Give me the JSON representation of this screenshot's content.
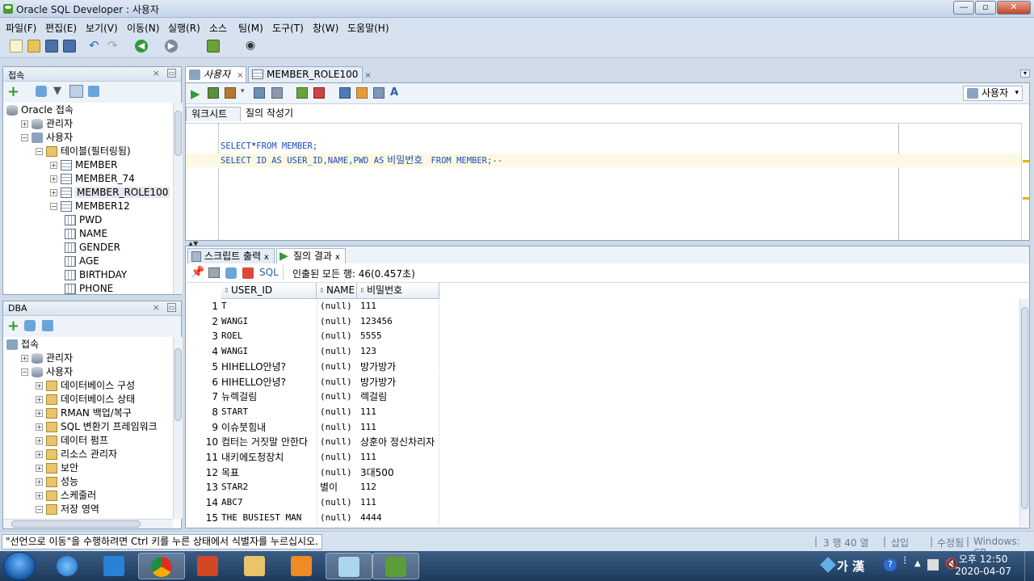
{
  "window": {
    "title": "Oracle SQL Developer : 사용자"
  },
  "menu": [
    "파일(F)",
    "편집(E)",
    "보기(V)",
    "이동(N)",
    "실행(R)",
    "소스",
    "팀(M)",
    "도구(T)",
    "창(W)",
    "도움말(H)"
  ],
  "connections_panel": {
    "title": "접속",
    "tree": [
      {
        "label": "Oracle 접속",
        "level": 0,
        "expander": "",
        "icon": "database-icon"
      },
      {
        "label": "관리자",
        "level": 1,
        "expander": "+",
        "icon": "database-icon"
      },
      {
        "label": "사용자",
        "level": 1,
        "expander": "−",
        "icon": "connection-icon"
      },
      {
        "label": "테이블(필터링됨)",
        "level": 2,
        "expander": "−",
        "icon": "folder-icon"
      },
      {
        "label": "MEMBER",
        "level": 3,
        "expander": "+",
        "icon": "table-icon"
      },
      {
        "label": "MEMBER_74",
        "level": 3,
        "expander": "+",
        "icon": "table-icon"
      },
      {
        "label": "MEMBER_ROLE100",
        "level": 3,
        "expander": "+",
        "icon": "table-icon",
        "selected": true
      },
      {
        "label": "MEMBER12",
        "level": 3,
        "expander": "−",
        "icon": "table-icon"
      },
      {
        "label": "PWD",
        "level": 4,
        "expander": "",
        "icon": "column-icon"
      },
      {
        "label": "NAME",
        "level": 4,
        "expander": "",
        "icon": "column-icon"
      },
      {
        "label": "GENDER",
        "level": 4,
        "expander": "",
        "icon": "column-icon"
      },
      {
        "label": "AGE",
        "level": 4,
        "expander": "",
        "icon": "column-icon"
      },
      {
        "label": "BIRTHDAY",
        "level": 4,
        "expander": "",
        "icon": "column-icon"
      },
      {
        "label": "PHONE",
        "level": 4,
        "expander": "",
        "icon": "column-icon"
      }
    ]
  },
  "dba_panel": {
    "title": "DBA",
    "tree": [
      {
        "label": "접속",
        "level": 0,
        "expander": "",
        "icon": "connection-icon"
      },
      {
        "label": "관리자",
        "level": 1,
        "expander": "+",
        "icon": "database-icon"
      },
      {
        "label": "사용자",
        "level": 1,
        "expander": "−",
        "icon": "database-icon"
      },
      {
        "label": "데이터베이스 구성",
        "level": 2,
        "expander": "+",
        "icon": "folder-icon"
      },
      {
        "label": "데이터베이스 상태",
        "level": 2,
        "expander": "+",
        "icon": "folder-icon"
      },
      {
        "label": "RMAN 백업/복구",
        "level": 2,
        "expander": "+",
        "icon": "folder-icon"
      },
      {
        "label": "SQL 변환기 프레임워크",
        "level": 2,
        "expander": "+",
        "icon": "folder-icon"
      },
      {
        "label": "데이터 펌프",
        "level": 2,
        "expander": "+",
        "icon": "folder-icon"
      },
      {
        "label": "리소스 관리자",
        "level": 2,
        "expander": "+",
        "icon": "folder-icon"
      },
      {
        "label": "보안",
        "level": 2,
        "expander": "+",
        "icon": "folder-icon"
      },
      {
        "label": "성능",
        "level": 2,
        "expander": "+",
        "icon": "folder-icon"
      },
      {
        "label": "스케줄러",
        "level": 2,
        "expander": "+",
        "icon": "folder-icon"
      },
      {
        "label": "저장 영역",
        "level": 2,
        "expander": "−",
        "icon": "folder-icon"
      }
    ]
  },
  "editor_tabs": [
    {
      "label": "사용자",
      "active": true
    },
    {
      "label": "MEMBER_ROLE100",
      "active": false
    }
  ],
  "connection_selector": "사용자",
  "worksheet_subtabs": [
    "워크시트",
    "질의 작성기"
  ],
  "sql": {
    "line1": {
      "a": "SELECT",
      "b": "*",
      "c": "FROM",
      "d": " MEMBER;"
    },
    "line2": {
      "a": "SELECT",
      "b": " ID ",
      "c": "AS",
      "d": " USER_ID,NAME,PWD ",
      "e": "AS",
      "f": " 비밀번호 ",
      "g": " FROM",
      "h": " MEMBER;--"
    }
  },
  "result_tabs": [
    {
      "label": "스크립트 출력",
      "active": false
    },
    {
      "label": "질의 결과",
      "active": true
    }
  ],
  "results_toolbar": {
    "sql_label": "SQL",
    "fetch_status": "인출된 모든 행: 46(0.457초)"
  },
  "grid": {
    "columns": [
      "USER_ID",
      "NAME",
      "비밀번호"
    ],
    "rows": [
      [
        "1",
        "T",
        "(null)",
        "111"
      ],
      [
        "2",
        "WANGI",
        "(null)",
        "123456"
      ],
      [
        "3",
        "ROEL",
        "(null)",
        "5555"
      ],
      [
        "4",
        "WANGI",
        "(null)",
        "123"
      ],
      [
        "5",
        "HIHELLO안녕?",
        "(null)",
        "방가방가"
      ],
      [
        "6",
        "HIHELLO안녕?",
        "(null)",
        "방가방가"
      ],
      [
        "7",
        "뉴렉걸림",
        "(null)",
        "렉걸림"
      ],
      [
        "8",
        "START",
        "(null)",
        "111"
      ],
      [
        "9",
        "이슈붓힘내",
        "(null)",
        "111"
      ],
      [
        "10",
        "컴터는 거짓말 안한다",
        "(null)",
        "상훈아 정신차리자"
      ],
      [
        "11",
        "내키에도청장치",
        "(null)",
        "111"
      ],
      [
        "12",
        "목표",
        "(null)",
        "3대500"
      ],
      [
        "13",
        "STAR2",
        "별이",
        "112"
      ],
      [
        "14",
        "ABC7",
        "(null)",
        "111"
      ],
      [
        "15",
        "THE BUSIEST MAN",
        "(null)",
        "4444"
      ]
    ]
  },
  "status": {
    "message": "\"선언으로 이동\"을 수행하려면 Ctrl 키를 누른 상태에서 식별자를 누르십시오.",
    "position": "3 행 40 열",
    "insert_mode": "삽입",
    "modified": "수정됨",
    "line_ending": "Windows: CR"
  },
  "tray": {
    "ime": "가 漢",
    "time": "오후 12:50",
    "date": "2020-04-07"
  }
}
